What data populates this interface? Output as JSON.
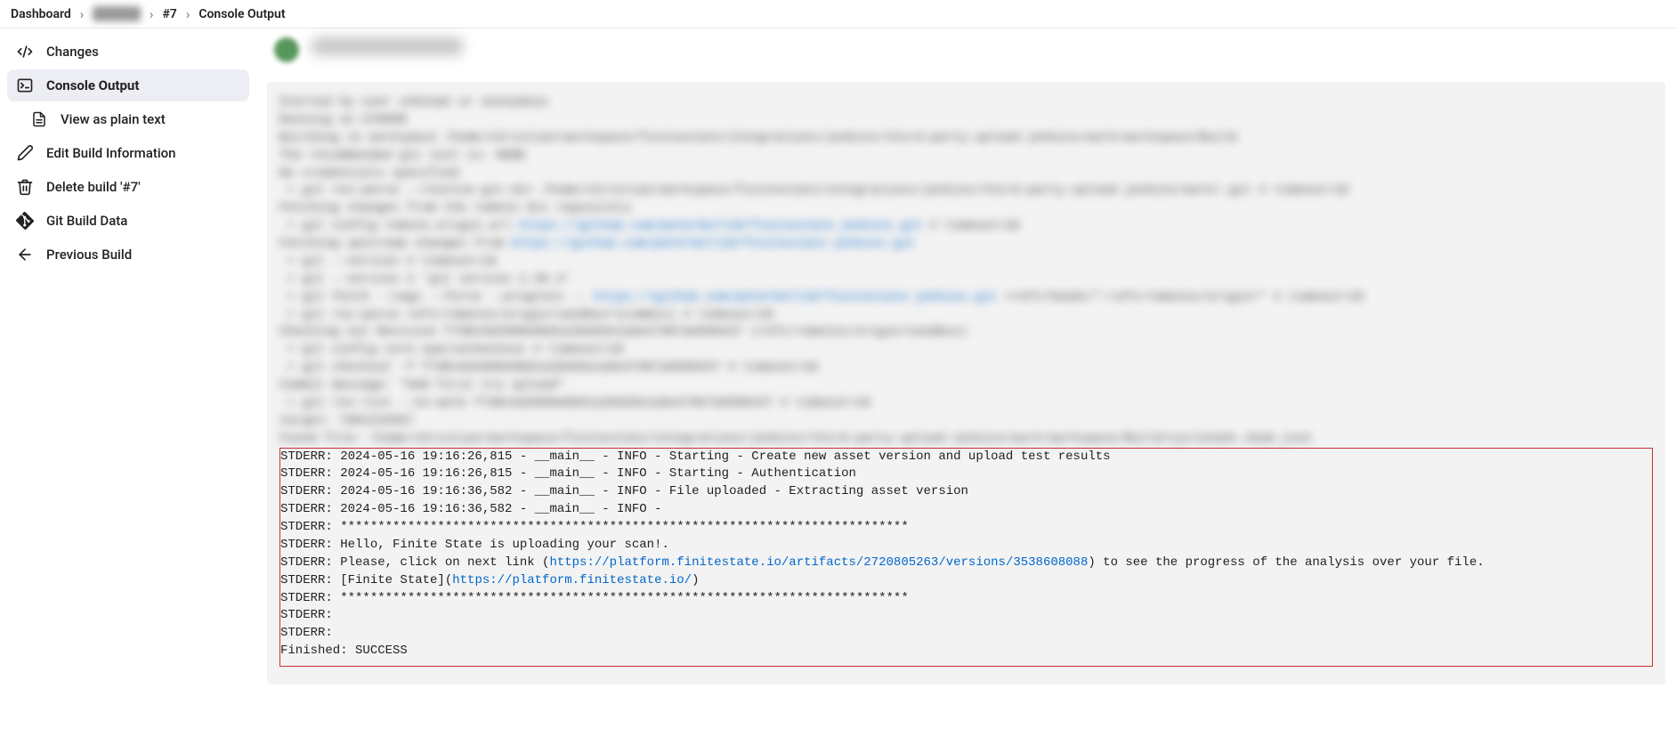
{
  "breadcrumb": {
    "dashboard": "Dashboard",
    "project": "█████",
    "build": "#7",
    "page": "Console Output"
  },
  "sidebar": {
    "changes": "Changes",
    "console": "Console Output",
    "viewplain": "View as plain text",
    "editinfo": "Edit Build Information",
    "deletebuild": "Delete build '#7'",
    "gitdata": "Git Build Data",
    "prevbuild": "Previous Build"
  },
  "blurred_log": "Started by user unknown or anonymous\nRunning on STDERR\nBuilding in workspace /home/christian/workspace/finitestate/integrations/jenkins/third-party-upload-jenkins/work/workspace/Build\nThe recommended git tool is: NONE\nNo credentials specified\n > git rev-parse --resolve-git-dir /home/christian/workspace/finitestate/integrations/jenkins/third-party-upload-jenkins/work/.git # timeout=10\nFetching changes from the remote Git repository\n > git config remote.origin.url <span class=\"fake-link\">https://github.com/peterbell10/finitestate-jenkins.git</span> # timeout=10\nFetching upstream changes from <span class=\"fake-link\">https://github.com/peterbell10/finitestate-jenkins.git</span>\n > git --version # timeout=10\n > git --version # 'git version 2.39.3'\n > git fetch --tags --force --progress -- <span class=\"fake-link\">https://github.com/peterbell10/finitestate-jenkins.git</span> +refs/heads/*:refs/remotes/origin/* # timeout=10\n > git rev-parse refs/remotes/origin/sandbox^{commit} # timeout=10\nChecking out Revision f7d8c6d2888e0b01a2b6d3e1a6e47967a6589437 (refs/remotes/origin/sandbox)\n > git config core.sparsecheckout # timeout=10\n > git checkout -f f7d8c6d2888e0b01a2b6d3e1a6e47967a6589437 # timeout=10\nCommit message: \"Add first try upload\"\n > git rev-list --no-walk f7d8c6d2888e0b01a2b6d3e1a6e47967a6589437 # timeout=10\ntarget: 7901234567\nFound file: /home/christian/workspace/finitestate/integrations/jenkins/third-party-upload-jenkins/work/workspace/Build/cyclonedx.sbom.json",
  "log_lines": {
    "l1": "STDERR: 2024-05-16 19:16:26,815 - __main__ - INFO - Starting - Create new asset version and upload test results",
    "l2": "STDERR: 2024-05-16 19:16:26,815 - __main__ - INFO - Starting - Authentication",
    "l3": "STDERR: 2024-05-16 19:16:36,582 - __main__ - INFO - File uploaded - Extracting asset version",
    "l4": "STDERR: 2024-05-16 19:16:36,582 - __main__ - INFO -",
    "l5": "STDERR: ****************************************************************************",
    "l6": "STDERR: Hello, Finite State is uploading your scan!.",
    "l7a": "STDERR: Please, click on next link (",
    "l7link": "https://platform.finitestate.io/artifacts/2720805263/versions/3538608088",
    "l7b": ") to see the progress of the analysis over your file.",
    "l8a": "STDERR: [Finite State](",
    "l8link": "https://platform.finitestate.io/",
    "l8b": ")",
    "l9": "STDERR: ****************************************************************************",
    "l10": "STDERR:",
    "l11": "STDERR:",
    "l12": "Finished: SUCCESS"
  }
}
